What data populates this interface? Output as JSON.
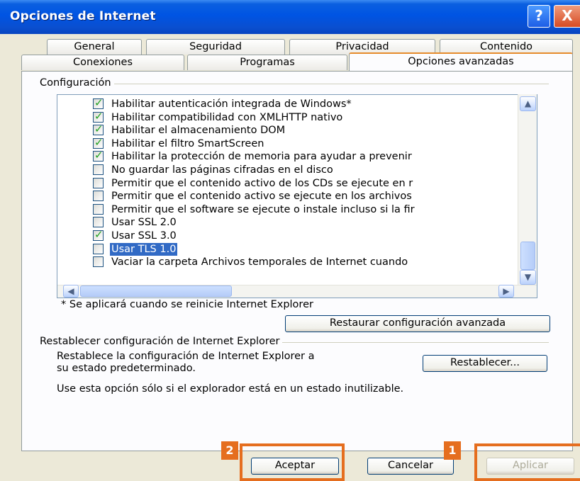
{
  "window": {
    "title": "Opciones de Internet",
    "help_label": "?",
    "close_label": "X"
  },
  "tabs": {
    "general": "General",
    "seguridad": "Seguridad",
    "privacidad": "Privacidad",
    "contenido": "Contenido",
    "conexiones": "Conexiones",
    "programas": "Programas",
    "avanzadas": "Opciones avanzadas"
  },
  "settings": {
    "group_label": "Configuración",
    "items": [
      {
        "label": "Habilitar autenticación integrada de Windows*",
        "checked": true,
        "selected": false
      },
      {
        "label": "Habilitar compatibilidad con XMLHTTP nativo",
        "checked": true,
        "selected": false
      },
      {
        "label": "Habilitar el almacenamiento DOM",
        "checked": true,
        "selected": false
      },
      {
        "label": "Habilitar el filtro SmartScreen",
        "checked": true,
        "selected": false
      },
      {
        "label": "Habilitar la protección de memoria para ayudar a prevenir",
        "checked": true,
        "selected": false
      },
      {
        "label": "No guardar las páginas cifradas en el disco",
        "checked": false,
        "selected": false
      },
      {
        "label": "Permitir que el contenido activo de los CDs se ejecute en r",
        "checked": false,
        "selected": false
      },
      {
        "label": "Permitir que el contenido activo se ejecute en los archivos",
        "checked": false,
        "selected": false
      },
      {
        "label": "Permitir que el software se ejecute o instale incluso si la fir",
        "checked": false,
        "selected": false
      },
      {
        "label": "Usar SSL 2.0",
        "checked": false,
        "selected": false
      },
      {
        "label": "Usar SSL 3.0",
        "checked": true,
        "selected": false
      },
      {
        "label": "Usar TLS 1.0",
        "checked": false,
        "selected": true
      },
      {
        "label": "Vaciar la carpeta Archivos temporales de Internet cuando",
        "checked": false,
        "selected": false
      }
    ],
    "restart_note": "* Se aplicará cuando se reinicie Internet Explorer",
    "restore_button": "Restaurar configuración avanzada"
  },
  "reset": {
    "group_label": "Restablecer configuración de Internet Explorer",
    "description_line1": "Restablece la configuración de Internet Explorer a",
    "description_line2": "su estado predeterminado.",
    "button": "Restablecer...",
    "warning": "Use esta opción sólo si el explorador está en un estado inutilizable."
  },
  "footer": {
    "accept": "Aceptar",
    "cancel": "Cancelar",
    "apply": "Aplicar",
    "badge_accept": "2",
    "badge_apply": "1"
  },
  "colors": {
    "highlight": "#e56e1f",
    "titlebar": "#0054e3",
    "selection": "#316ac5",
    "check": "#21a121"
  }
}
